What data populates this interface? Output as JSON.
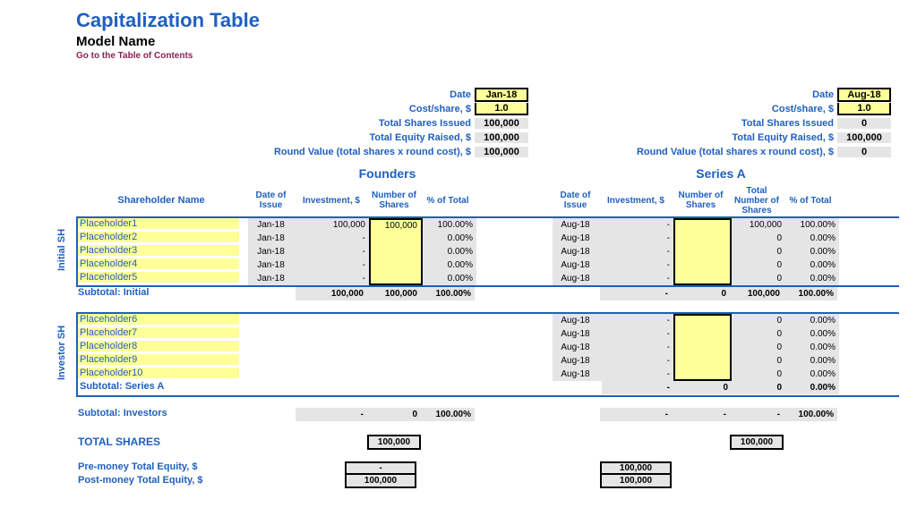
{
  "title": "Capitalization Table",
  "model_name": "Model Name",
  "toc_link": "Go to the Table of Contents",
  "summary_labels": {
    "date": "Date",
    "cost": "Cost/share, $",
    "shares": "Total Shares Issued",
    "equity": "Total Equity Raised, $",
    "round_value": "Round Value (total shares x round cost), $"
  },
  "founders": {
    "title": "Founders",
    "summary": {
      "date": "Jan-18",
      "cost": "1.0",
      "shares": "100,000",
      "equity": "100,000",
      "round_value": "100,000"
    },
    "headers": {
      "date": "Date of Issue",
      "inv": "Investment, $",
      "num": "Number of Shares",
      "pct": "% of Total"
    }
  },
  "seriesA": {
    "title": "Series A",
    "summary": {
      "date": "Aug-18",
      "cost": "1.0",
      "shares": "0",
      "equity": "100,000",
      "round_value": "0"
    },
    "headers": {
      "date": "Date of Issue",
      "inv": "Investment, $",
      "num": "Number of Shares",
      "total": "Total Number of Shares",
      "pct": "% of Total"
    }
  },
  "shareholder_header": "Shareholder Name",
  "initial_label": "Initial SH",
  "investor_label": "Investor SH",
  "initial": [
    {
      "name": "Placeholder1",
      "f_date": "Jan-18",
      "f_inv": "100,000",
      "f_num": "100,000",
      "f_pct": "100.00%",
      "a_date": "Aug-18",
      "a_inv": "-",
      "a_num": "",
      "a_total": "100,000",
      "a_pct": "100.00%"
    },
    {
      "name": "Placeholder2",
      "f_date": "Jan-18",
      "f_inv": "-",
      "f_num": "",
      "f_pct": "0.00%",
      "a_date": "Aug-18",
      "a_inv": "-",
      "a_num": "",
      "a_total": "0",
      "a_pct": "0.00%"
    },
    {
      "name": "Placeholder3",
      "f_date": "Jan-18",
      "f_inv": "-",
      "f_num": "",
      "f_pct": "0.00%",
      "a_date": "Aug-18",
      "a_inv": "-",
      "a_num": "",
      "a_total": "0",
      "a_pct": "0.00%"
    },
    {
      "name": "Placeholder4",
      "f_date": "Jan-18",
      "f_inv": "-",
      "f_num": "",
      "f_pct": "0.00%",
      "a_date": "Aug-18",
      "a_inv": "-",
      "a_num": "",
      "a_total": "0",
      "a_pct": "0.00%"
    },
    {
      "name": "Placeholder5",
      "f_date": "Jan-18",
      "f_inv": "-",
      "f_num": "",
      "f_pct": "0.00%",
      "a_date": "Aug-18",
      "a_inv": "-",
      "a_num": "",
      "a_total": "0",
      "a_pct": "0.00%"
    }
  ],
  "initial_subtotal": {
    "label": "Subtotal: Initial",
    "f_inv": "100,000",
    "f_num": "100,000",
    "f_pct": "100.00%",
    "a_inv": "-",
    "a_num": "0",
    "a_total": "100,000",
    "a_pct": "100.00%"
  },
  "investors": [
    {
      "name": "Placeholder6",
      "a_date": "Aug-18",
      "a_inv": "-",
      "a_num": "",
      "a_total": "0",
      "a_pct": "0.00%"
    },
    {
      "name": "Placeholder7",
      "a_date": "Aug-18",
      "a_inv": "-",
      "a_num": "",
      "a_total": "0",
      "a_pct": "0.00%"
    },
    {
      "name": "Placeholder8",
      "a_date": "Aug-18",
      "a_inv": "-",
      "a_num": "",
      "a_total": "0",
      "a_pct": "0.00%"
    },
    {
      "name": "Placeholder9",
      "a_date": "Aug-18",
      "a_inv": "-",
      "a_num": "",
      "a_total": "0",
      "a_pct": "0.00%"
    },
    {
      "name": "Placeholder10",
      "a_date": "Aug-18",
      "a_inv": "-",
      "a_num": "",
      "a_total": "0",
      "a_pct": "0.00%"
    }
  ],
  "seriesA_subtotal": {
    "label": "Subtotal: Series A",
    "a_inv": "-",
    "a_num": "0",
    "a_total": "0",
    "a_pct": "0.00%"
  },
  "investors_subtotal": {
    "label": "Subtotal: Investors",
    "f_inv": "-",
    "f_num": "0",
    "f_pct": "100.00%",
    "a_inv": "-",
    "a_num": "-",
    "a_total": "-",
    "a_pct": "100.00%"
  },
  "totals": {
    "shares_label": "TOTAL SHARES",
    "f_shares": "100,000",
    "a_shares": "100,000",
    "pre_label": "Pre-money Total Equity, $",
    "post_label": "Post-money Total Equity, $",
    "f_pre": "-",
    "f_post": "100,000",
    "a_pre": "100,000",
    "a_post": "100,000"
  }
}
